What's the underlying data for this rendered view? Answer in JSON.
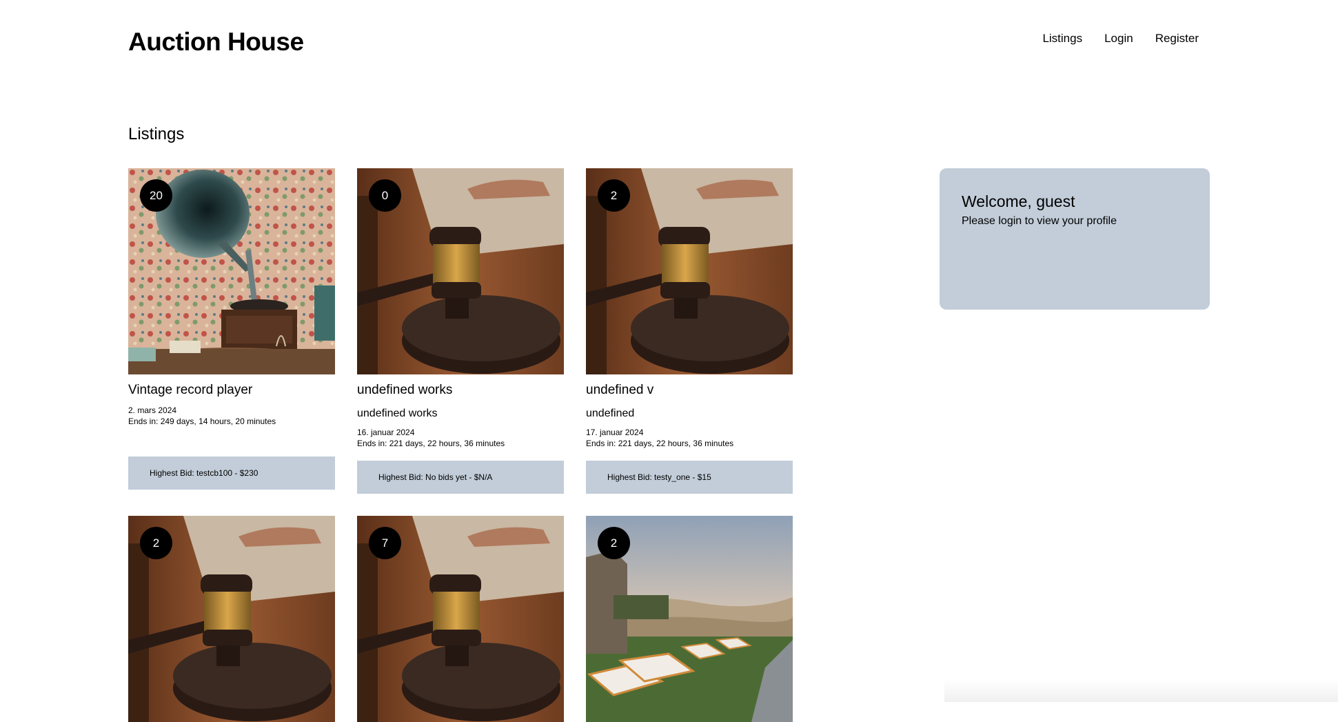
{
  "header": {
    "site_title": "Auction House",
    "nav": [
      "Listings",
      "Login",
      "Register"
    ]
  },
  "main": {
    "section_title": "Listings",
    "listings": [
      {
        "image": "gramophone-photo",
        "bid_count": "20",
        "title": "Vintage record player",
        "description": "",
        "date": "2. mars 2024",
        "ends_in": "Ends in: 249 days, 14 hours, 20 minutes",
        "highest_bid": "Highest Bid: testcb100 - $230"
      },
      {
        "image": "gavel-photo",
        "bid_count": "0",
        "title": "undefined works",
        "description": "undefined works",
        "date": "16. januar 2024",
        "ends_in": "Ends in: 221 days, 22 hours, 36 minutes",
        "highest_bid": "Highest Bid: No bids yet - $N/A"
      },
      {
        "image": "gavel-photo",
        "bid_count": "2",
        "title": "undefined v",
        "description": "undefined",
        "date": "17. januar 2024",
        "ends_in": "Ends in: 221 days, 22 hours, 36 minutes",
        "highest_bid": "Highest Bid: testy_one - $15"
      },
      {
        "image": "gavel-photo",
        "bid_count": "2"
      },
      {
        "image": "gavel-photo",
        "bid_count": "7"
      },
      {
        "image": "landscape-photo",
        "bid_count": "2"
      }
    ]
  },
  "sidebar": {
    "welcome_title": "Welcome, guest",
    "welcome_text": "Please login to view your profile"
  },
  "colors": {
    "accent": "#c2cdd9",
    "badge": "#000000",
    "background": "#ffffff"
  }
}
